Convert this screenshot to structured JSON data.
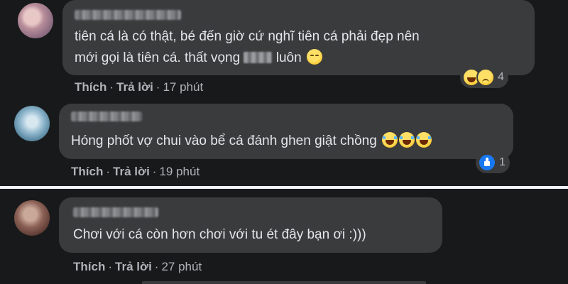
{
  "comments": [
    {
      "text_lines": [
        "tiên cá là có thật, bé đến giờ cứ nghĩ tiên cá phải đẹp nên",
        "mới gọi là tiên cá. thất vọng",
        "luôn"
      ],
      "emojis": [
        "pensive-face-emoji"
      ],
      "actions": {
        "like": "Thích",
        "reply": "Trả lời",
        "sep": "·",
        "time": "17 phút"
      },
      "reaction_count": "4",
      "reaction_icons": [
        "haha-reaction-icon",
        "sad-reaction-icon"
      ]
    },
    {
      "text_lines": [
        "Hóng phốt vợ chui vào bể cá đánh ghen giật chồng"
      ],
      "emojis": [
        "tears-of-joy-emoji",
        "tears-of-joy-emoji",
        "tears-of-joy-emoji"
      ],
      "actions": {
        "like": "Thích",
        "reply": "Trả lời",
        "sep": "·",
        "time": "19 phút"
      },
      "reaction_count": "1",
      "reaction_icons": [
        "like-reaction-icon"
      ]
    },
    {
      "text_lines": [
        "Chơi với cá còn hơn chơi với tu ét đây bạn ơi :)))"
      ],
      "emojis": [],
      "actions": {
        "like": "Thích",
        "reply": "Trả lời",
        "sep": "·",
        "time": "27 phút"
      }
    }
  ],
  "colors": {
    "background": "#18191a",
    "bubble": "#3a3b3c",
    "text": "#e4e6eb",
    "secondary_text": "#b0b3b8",
    "divider": "#f0f2f5",
    "like_blue": "#1877f2"
  }
}
